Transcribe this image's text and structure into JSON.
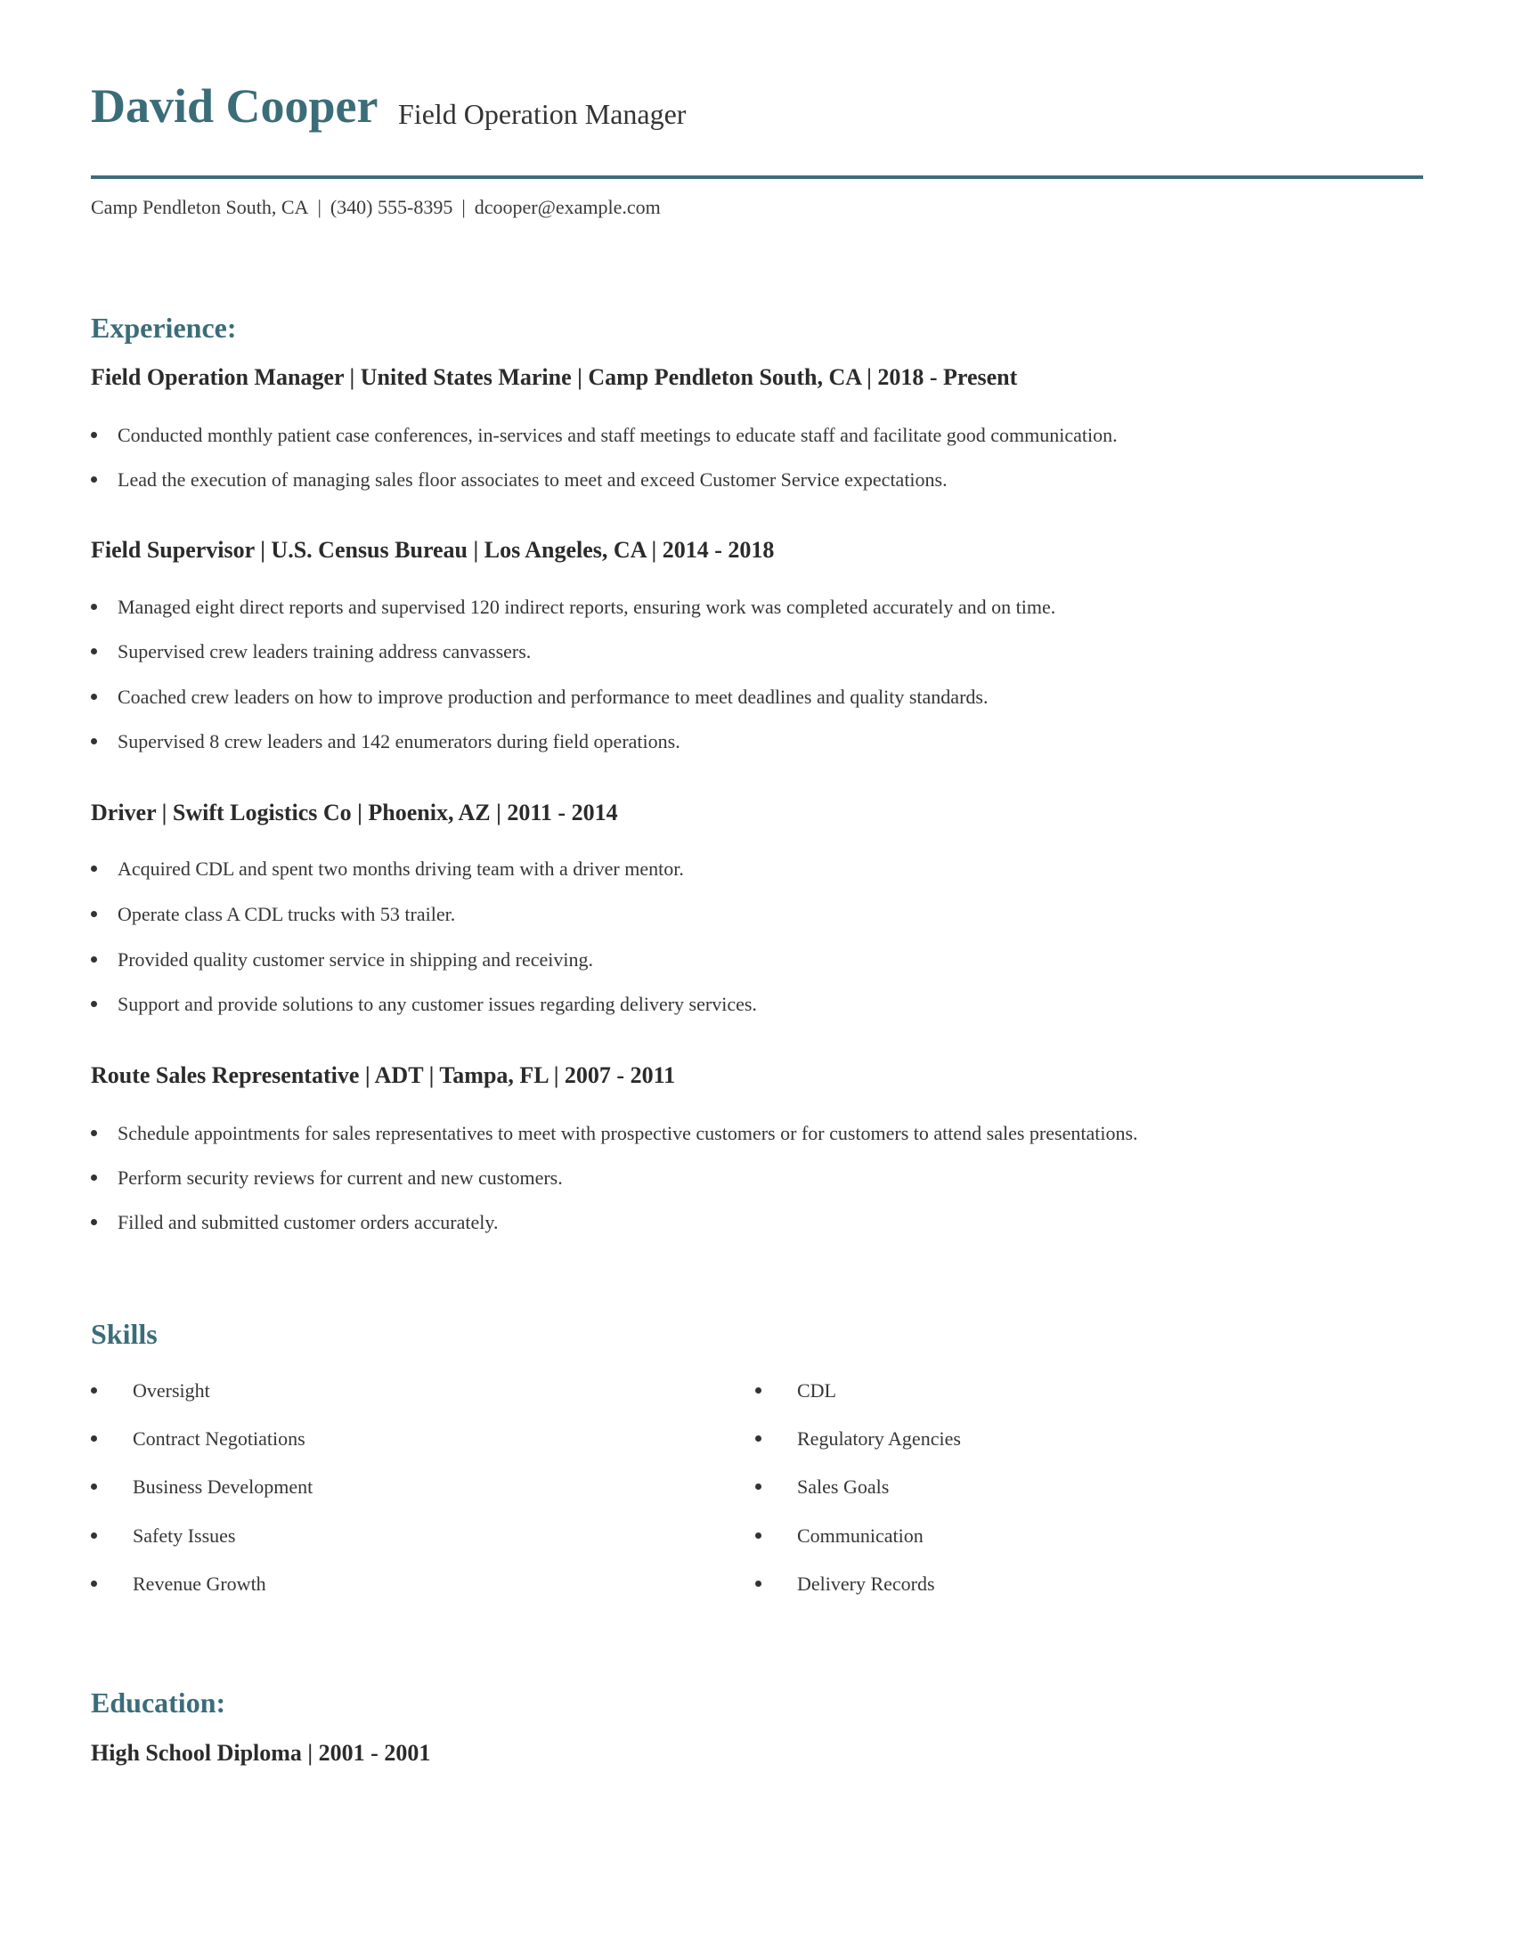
{
  "header": {
    "name": "David Cooper",
    "title": "Field Operation Manager",
    "contact": {
      "location": "Camp Pendleton South, CA",
      "phone": "(340) 555-8395",
      "email": "dcooper@example.com",
      "separator": "|"
    },
    "accent_color": "#3b6d79"
  },
  "experience": {
    "heading": "Experience:",
    "jobs": [
      {
        "header": "Field Operation Manager | United States Marine | Camp Pendleton South, CA |  2018 - Present",
        "bullets": [
          "Conducted monthly patient case conferences, in-services and staff meetings to educate staff and facilitate good communication.",
          "Lead the execution of managing sales floor associates to meet and exceed Customer Service expectations."
        ]
      },
      {
        "header": "Field Supervisor | U.S. Census Bureau | Los Angeles, CA |  2014 - 2018",
        "bullets": [
          "Managed eight direct reports and supervised 120 indirect reports, ensuring work was completed accurately and on time.",
          "Supervised crew leaders training address canvassers.",
          "Coached crew leaders on how to improve production and performance to meet deadlines and quality standards.",
          "Supervised 8 crew leaders and 142 enumerators during field operations."
        ]
      },
      {
        "header": "Driver | Swift Logistics Co | Phoenix, AZ |  2011 - 2014",
        "bullets": [
          "Acquired CDL and spent two months driving team with a driver mentor.",
          "Operate class A CDL trucks with 53 trailer.",
          "Provided quality customer service in shipping and receiving.",
          "Support and provide solutions to any customer issues regarding delivery services."
        ]
      },
      {
        "header": "Route Sales Representative | ADT | Tampa, FL |  2007 - 2011",
        "bullets": [
          "Schedule appointments for sales representatives to meet with prospective customers or for customers to attend sales presentations.",
          "Perform security reviews for current and new customers.",
          "Filled and submitted customer orders accurately."
        ]
      }
    ]
  },
  "skills": {
    "heading": "Skills",
    "left": [
      "Oversight",
      "Contract Negotiations",
      "Business Development",
      "Safety Issues",
      "Revenue Growth"
    ],
    "right": [
      "CDL",
      "Regulatory Agencies",
      "Sales Goals",
      "Communication",
      "Delivery Records"
    ]
  },
  "education": {
    "heading": "Education:",
    "entries": [
      "High School Diploma |  2001 - 2001"
    ]
  }
}
